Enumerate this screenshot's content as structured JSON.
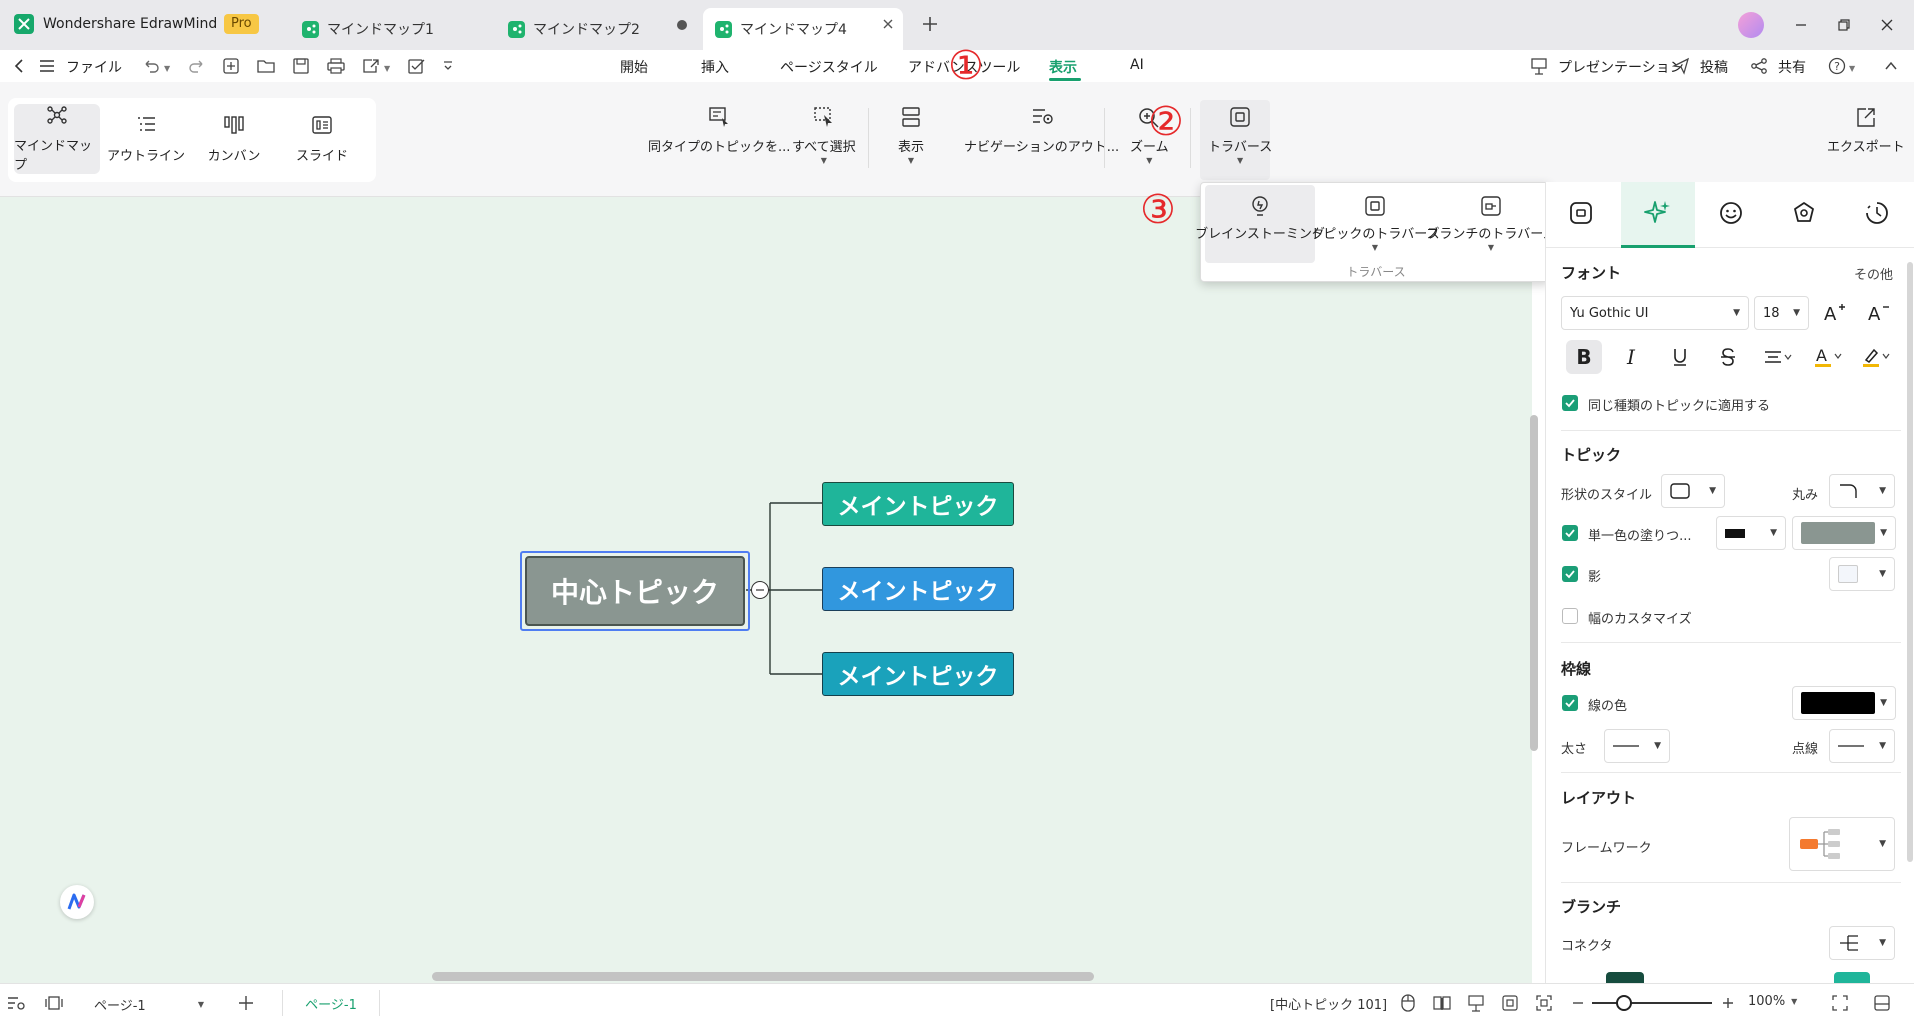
{
  "app": {
    "name": "Wondershare EdrawMind",
    "badge": "Pro"
  },
  "tabs": [
    {
      "label": "マインドマップ1"
    },
    {
      "label": "マインドマップ2"
    },
    {
      "label": "マインドマップ4"
    }
  ],
  "menubar": {
    "file": "ファイル",
    "items": [
      "開始",
      "挿入",
      "ページスタイル",
      "アドバンスツール",
      "表示",
      "AI"
    ],
    "active": "表示",
    "right": {
      "present": "プレゼンテーション",
      "post": "投稿",
      "share": "共有"
    }
  },
  "ribbon": {
    "views": [
      "マインドマップ",
      "アウトライン",
      "カンバン",
      "スライド"
    ],
    "select_same": "同タイプのトピックを...",
    "select_all": "すべて選択",
    "display": "表示",
    "nav_outline": "ナビゲーションのアウト...",
    "zoom": "ズーム",
    "traverse": "トラバース",
    "export": "エクスポート"
  },
  "popup": {
    "items": [
      "ブレインストーミング",
      "トピックのトラバース",
      "ブランチのトラバース"
    ],
    "group_label": "トラバース"
  },
  "annotations": [
    "①",
    "②",
    "③"
  ],
  "mindmap": {
    "central": "中心トピック",
    "mains": [
      "メイントピック",
      "メイントピック",
      "メイントピック"
    ],
    "main_colors": [
      "#1fb59a",
      "#3197de",
      "#1aa2bb"
    ],
    "central_color": "#8a9691"
  },
  "panel": {
    "font_section": "フォント",
    "more": "その他",
    "font_name": "Yu Gothic UI",
    "font_size": "18",
    "apply_same": "同じ種類のトピックに適用する",
    "topic_section": "トピック",
    "shape_style": "形状のスタイル",
    "round": "丸み",
    "single_fill": "単一色の塗りつ...",
    "shadow": "影",
    "custom_width": "幅のカスタマイズ",
    "border_section": "枠線",
    "line_color": "線の色",
    "thickness": "太さ",
    "dotted": "点線",
    "layout_section": "レイアウト",
    "framework": "フレームワーク",
    "branch_section": "ブランチ",
    "connector": "コネクタ"
  },
  "status": {
    "page_select": "ページ-1",
    "page_tab": "ページ-1",
    "selection": "[中心トピック 101]",
    "zoom": "100%"
  }
}
